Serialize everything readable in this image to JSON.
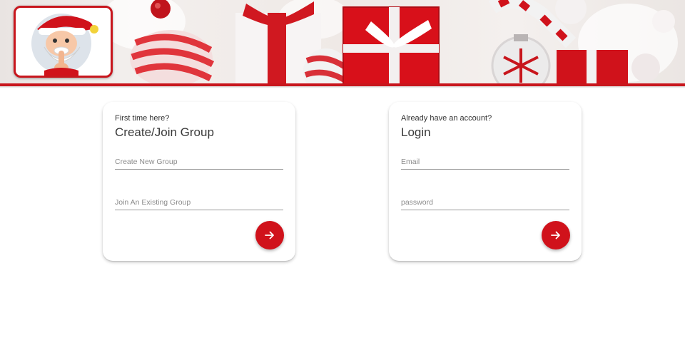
{
  "header": {
    "logo": {
      "icon": "santa-shush-icon"
    },
    "banner": {
      "theme": "christmas-gifts-and-ornaments",
      "accent_color": "#c8161d"
    }
  },
  "create_join": {
    "eyebrow": "First time here?",
    "title": "Create/Join Group",
    "create_field": {
      "value": "",
      "placeholder": "Create New Group"
    },
    "join_field": {
      "value": "",
      "placeholder": "Join An Existing Group"
    },
    "submit_icon": "arrow-right-icon"
  },
  "login": {
    "eyebrow": "Already have an account?",
    "title": "Login",
    "email_field": {
      "value": "",
      "placeholder": "Email"
    },
    "password_field": {
      "value": "",
      "placeholder": "password"
    },
    "submit_icon": "arrow-right-icon"
  },
  "colors": {
    "primary_red": "#d0121b",
    "card_bg": "#ffffff",
    "text": "#3a3a3a"
  }
}
